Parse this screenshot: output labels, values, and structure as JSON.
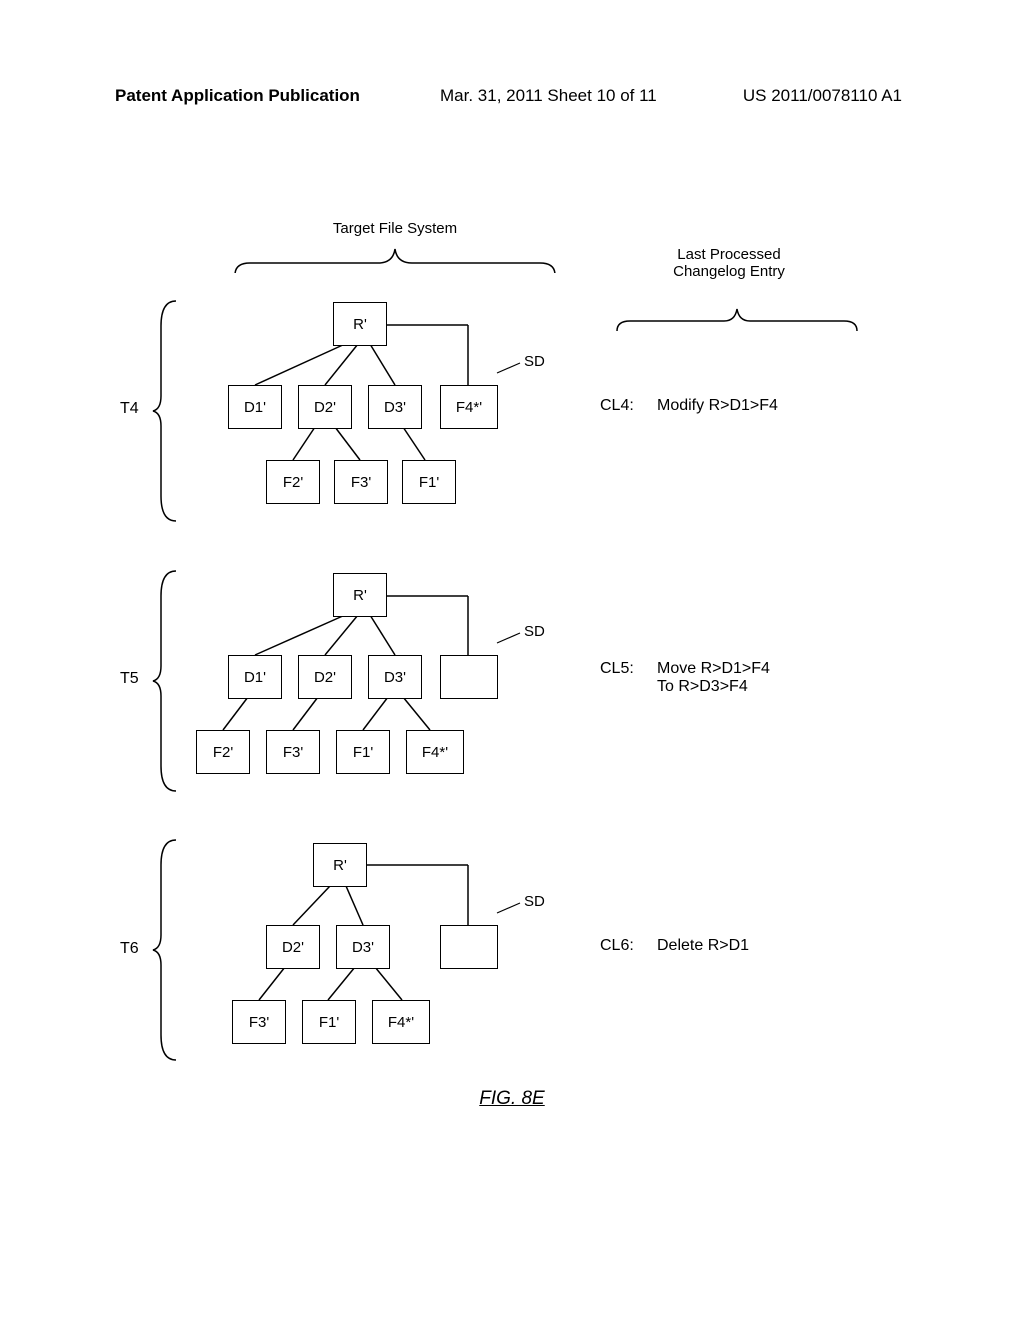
{
  "header": {
    "left": "Patent Application Publication",
    "mid": "Mar. 31, 2011  Sheet 10 of 11",
    "right": "US 2011/0078110 A1"
  },
  "columns": {
    "fs": "Target File System",
    "cl": "Last Processed\nChangelog Entry"
  },
  "sd": "SD",
  "fig": "FIG. 8E",
  "timesteps": [
    {
      "id": "T4",
      "nodes": {
        "R": "R'",
        "row2": [
          "D1'",
          "D2'",
          "D3'",
          "F4*'"
        ],
        "row3": [
          "F2'",
          "F3'",
          "F1'"
        ]
      },
      "cl_label": "CL4:",
      "cl_text": "Modify R>D1>F4"
    },
    {
      "id": "T5",
      "nodes": {
        "R": "R'",
        "row2": [
          "D1'",
          "D2'",
          "D3'",
          ""
        ],
        "row3": [
          "F2'",
          "F3'",
          "F1'",
          "F4*'"
        ]
      },
      "cl_label": "CL5:",
      "cl_text": "Move R>D1>F4\nTo R>D3>F4"
    },
    {
      "id": "T6",
      "nodes": {
        "R": "R'",
        "row2": [
          "D2'",
          "D3'",
          ""
        ],
        "row3": [
          "F3'",
          "F1'",
          "F4*'"
        ]
      },
      "cl_label": "CL6:",
      "cl_text": "Delete R>D1"
    }
  ]
}
